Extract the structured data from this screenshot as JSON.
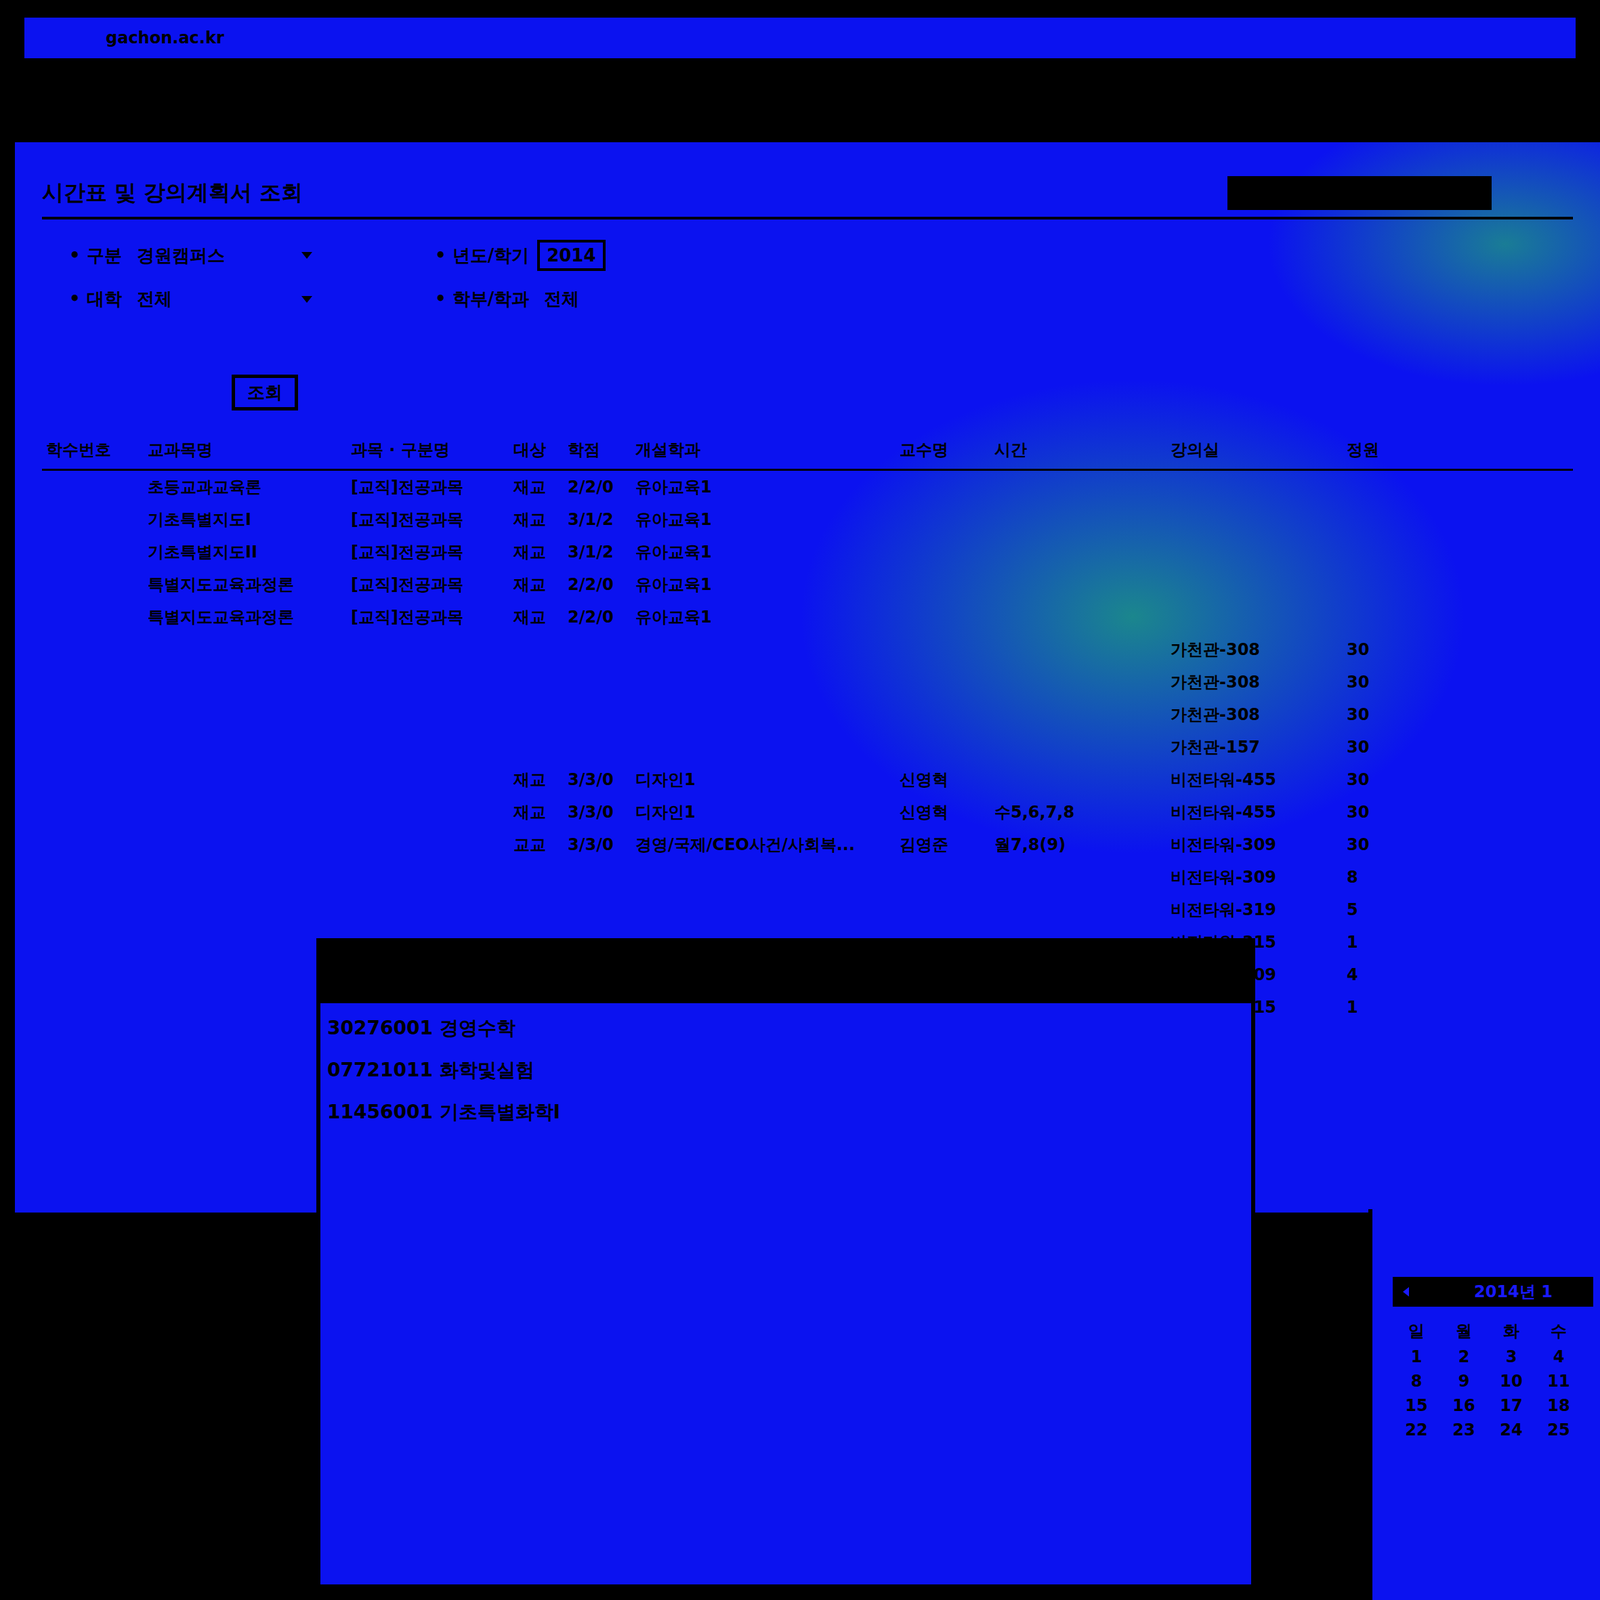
{
  "browser": {
    "url": "gachon.ac.kr"
  },
  "page": {
    "title": "시간표 및 강의계획서 조회",
    "filters": [
      {
        "label": "구분",
        "value": "경원캠퍼스",
        "kind": "select"
      },
      {
        "label": "년도/학기",
        "value": "2014",
        "kind": "box"
      },
      {
        "label": "대학",
        "value": "전체",
        "kind": "select"
      },
      {
        "label": "학부/학과",
        "value": "전체",
        "kind": "text"
      }
    ],
    "search_button": "조회"
  },
  "table": {
    "columns": [
      "학수번호",
      "교과목명",
      "과목 · 구분명",
      "대상",
      "학점",
      "개설학과",
      "교수명",
      "시간",
      "강의실",
      "정원"
    ],
    "rows": [
      {
        "cells": [
          "",
          "초등교과교육론",
          "[교직]전공과목",
          "재교",
          "2/2/0",
          "유아교육1",
          "",
          "",
          "",
          ""
        ]
      },
      {
        "cells": [
          "",
          "기초특별지도I",
          "[교직]전공과목",
          "재교",
          "3/1/2",
          "유아교육1",
          "",
          "",
          "",
          ""
        ]
      },
      {
        "cells": [
          "",
          "기초특별지도II",
          "[교직]전공과목",
          "재교",
          "3/1/2",
          "유아교육1",
          "",
          "",
          "",
          ""
        ]
      },
      {
        "cells": [
          "",
          "특별지도교육과정론",
          "[교직]전공과목",
          "재교",
          "2/2/0",
          "유아교육1",
          "",
          "",
          "",
          ""
        ]
      },
      {
        "cells": [
          "",
          "특별지도교육과정론",
          "[교직]전공과목",
          "재교",
          "2/2/0",
          "유아교육1",
          "",
          "",
          "",
          ""
        ]
      },
      {
        "cells": [
          "",
          "",
          "",
          "",
          "",
          "",
          "",
          "",
          "가천관-308",
          "30"
        ]
      },
      {
        "cells": [
          "",
          "",
          "",
          "",
          "",
          "",
          "",
          "",
          "가천관-308",
          "30"
        ]
      },
      {
        "cells": [
          "",
          "",
          "",
          "",
          "",
          "",
          "",
          "",
          "가천관-308",
          "30"
        ]
      },
      {
        "cells": [
          "",
          "",
          "",
          "",
          "",
          "",
          "",
          "",
          "가천관-157",
          "30"
        ]
      },
      {
        "cells": [
          "",
          "",
          "",
          "재교",
          "3/3/0",
          "디자인1",
          "신영혁",
          "",
          "비전타워-455",
          "30"
        ]
      },
      {
        "cells": [
          "",
          "",
          "",
          "재교",
          "3/3/0",
          "디자인1",
          "신영혁",
          "수5,6,7,8",
          "비전타워-455",
          "30"
        ]
      },
      {
        "cells": [
          "",
          "",
          "",
          "교교",
          "3/3/0",
          "경영/국제/CEO사건/사회복...",
          "김영준",
          "월7,8(9)",
          "비전타워-309",
          "30"
        ]
      },
      {
        "cells": [
          "",
          "",
          "",
          "",
          "",
          "",
          "",
          "",
          "비전타워-309",
          "8"
        ]
      },
      {
        "cells": [
          "",
          "",
          "",
          "",
          "",
          "",
          "",
          "",
          "비전타워-319",
          "5"
        ]
      },
      {
        "cells": [
          "",
          "",
          "",
          "",
          "",
          "",
          "",
          "",
          "비전타워-315",
          "1"
        ]
      },
      {
        "cells": [
          "",
          "",
          "",
          "",
          "",
          "",
          "",
          "",
          "비전타워-309",
          "4"
        ]
      },
      {
        "cells": [
          "",
          "",
          "",
          "",
          "",
          "",
          "",
          "",
          "비전타워-315",
          "1"
        ]
      }
    ]
  },
  "popup": {
    "items": [
      "30276001 경영수학",
      "07721011 화학및실험",
      "11456001 기초특별화학I"
    ]
  },
  "calendar": {
    "title": "2014년 1",
    "weekdays": [
      "일",
      "월",
      "화",
      "수"
    ],
    "weeks": [
      [
        "1",
        "2",
        "3",
        "4"
      ],
      [
        "8",
        "9",
        "10",
        "11"
      ],
      [
        "15",
        "16",
        "17",
        "18"
      ],
      [
        "22",
        "23",
        "24",
        "25"
      ]
    ]
  }
}
